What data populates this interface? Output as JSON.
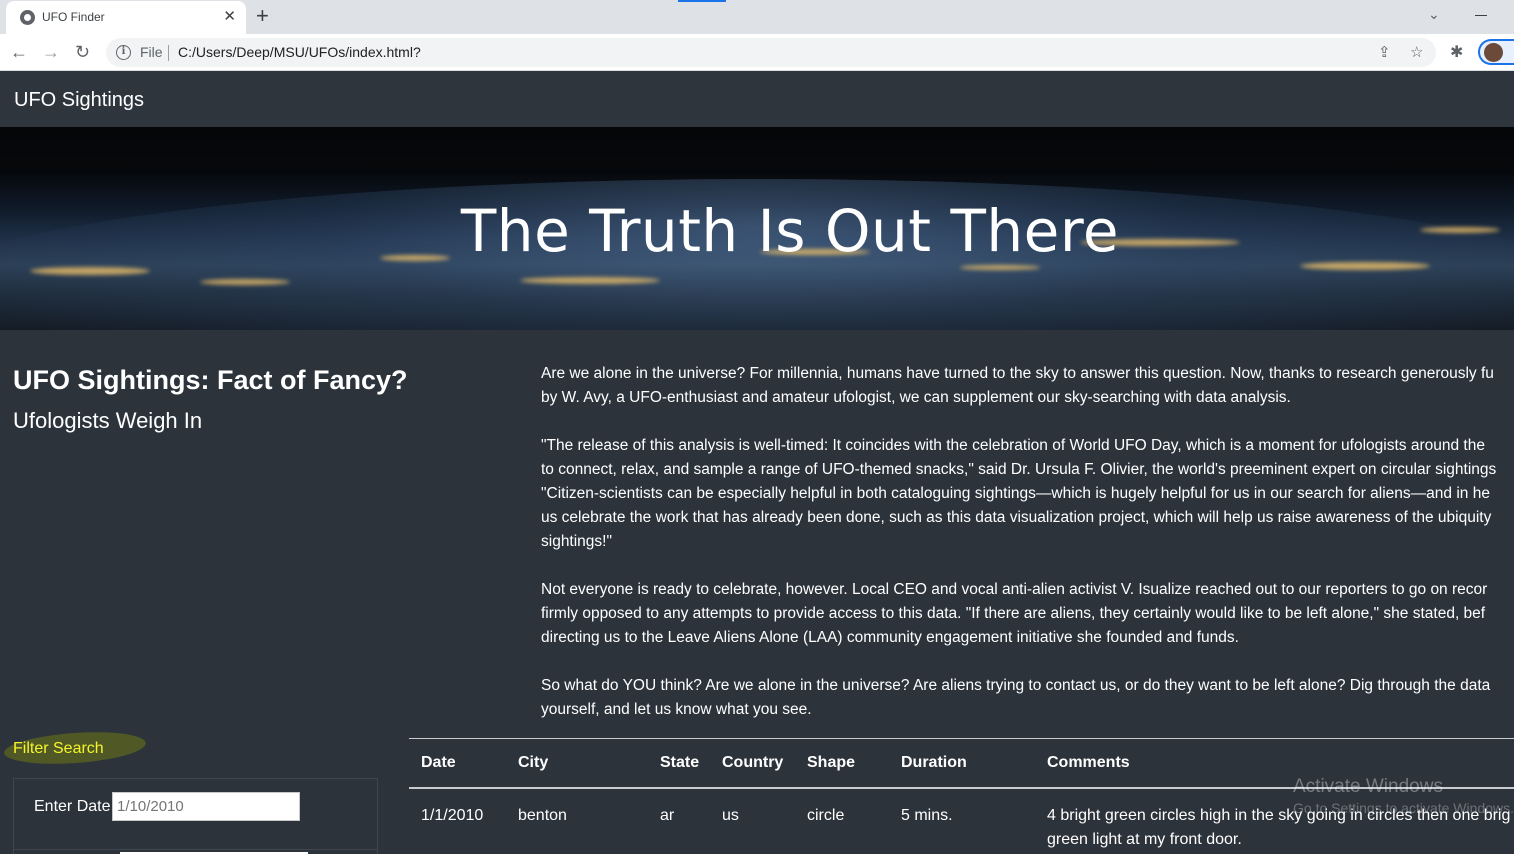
{
  "browser": {
    "tab_title": "UFO Finder",
    "tab_close": "✕",
    "new_tab": "+",
    "file_label": "File",
    "url": "C:/Users/Deep/MSU/UFOs/index.html?",
    "back": "←",
    "forward": "→",
    "reload": "↻",
    "share": "⇪",
    "star": "☆",
    "extensions": "✱",
    "tab_search": "⌄"
  },
  "navbar": {
    "brand": "UFO Sightings"
  },
  "hero": {
    "title": "The Truth Is Out There"
  },
  "headline": {
    "main": "UFO Sightings: Fact of Fancy?",
    "sub": "Ufologists Weigh In"
  },
  "article": {
    "p1_l1": "Are we alone in the universe? For millennia, humans have turned to the sky to answer this question. Now, thanks to research generously fu",
    "p1_l2": "by W. Avy, a UFO-enthusiast and amateur ufologist, we can supplement our sky-searching with data analysis.",
    "p2_l1": "\"The release of this analysis is well-timed: It coincides with the celebration of World UFO Day, which is a moment for ufologists around the",
    "p2_l2": "to connect, relax, and sample a range of UFO-themed snacks,\" said Dr. Ursula F. Olivier, the world's preeminent expert on circular sightings",
    "p2_l3": "\"Citizen-scientists can be especially helpful in both cataloguing sightings—which is hugely helpful for us in our search for aliens—and in he",
    "p2_l4": "us celebrate the work that has already been done, such as this data visualization project, which will help us raise awareness of the ubiquity",
    "p2_l5": "sightings!\"",
    "p3_l1": "Not everyone is ready to celebrate, however. Local CEO and vocal anti-alien activist V. Isualize reached out to our reporters to go on recor",
    "p3_l2": "firmly opposed to any attempts to provide access to this data. \"If there are aliens, they certainly would like to be left alone,\" she stated, bef",
    "p3_l3": "directing us to the Leave Aliens Alone (LAA) community engagement initiative she founded and funds.",
    "p4_l1": "So what do YOU think? Are we alone in the universe? Are aliens trying to contact us, or do they want to be left alone? Dig through the data",
    "p4_l2": "yourself, and let us know what you see."
  },
  "filter": {
    "title": "Filter Search",
    "date_label": "Enter Date",
    "date_placeholder": "1/10/2010"
  },
  "table": {
    "headers": [
      "Date",
      "City",
      "State",
      "Country",
      "Shape",
      "Duration",
      "Comments"
    ],
    "rows": [
      {
        "date": "1/1/2010",
        "city": "benton",
        "state": "ar",
        "country": "us",
        "shape": "circle",
        "duration": "5 mins.",
        "comments_l1": "4 bright green circles high in the sky going in circles then one brig",
        "comments_l2": "green light at my front door."
      }
    ]
  },
  "watermark": {
    "line1": "Activate Windows",
    "line2": "Go to Settings to activate Windows."
  }
}
